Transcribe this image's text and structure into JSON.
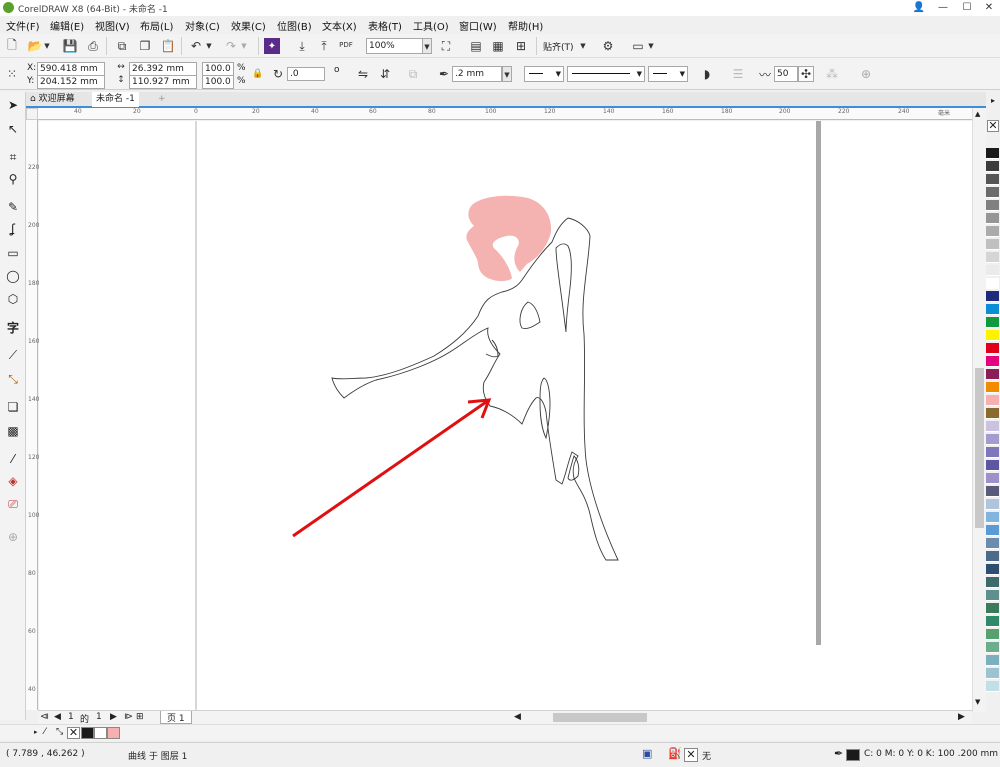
{
  "window": {
    "title": "CorelDRAW X8 (64-Bit) - 未命名 -1",
    "min": "—",
    "max": "☐",
    "close": "✕",
    "user_icon": "👤"
  },
  "menu": [
    {
      "label": "文件(F)"
    },
    {
      "label": "编辑(E)"
    },
    {
      "label": "视图(V)"
    },
    {
      "label": "布局(L)"
    },
    {
      "label": "对象(C)"
    },
    {
      "label": "效果(C)"
    },
    {
      "label": "位图(B)"
    },
    {
      "label": "文本(X)"
    },
    {
      "label": "表格(T)"
    },
    {
      "label": "工具(O)"
    },
    {
      "label": "窗口(W)"
    },
    {
      "label": "帮助(H)"
    }
  ],
  "toolbar": {
    "zoom": "100%",
    "snap_label": "贴齐(T)",
    "pdf_label": "PDF"
  },
  "propbar": {
    "x_label": "X:",
    "x_value": "590.418 mm",
    "y_label": "Y:",
    "y_value": "204.152 mm",
    "w_value": "26.392 mm",
    "h_value": "110.927 mm",
    "sx_value": "100.0",
    "sy_value": "100.0",
    "pct": "%",
    "rotation": ".0",
    "deg": "o",
    "outline_width": ".2 mm",
    "smooth_value": "50"
  },
  "doctabs": {
    "welcome": "欢迎屏幕",
    "doc": "未命名 -1",
    "add": "+"
  },
  "ruler": {
    "h_ticks": [
      "40",
      "20",
      "0",
      "20",
      "40",
      "60",
      "80",
      "100",
      "120",
      "140",
      "160",
      "180",
      "200",
      "220",
      "240"
    ],
    "v_ticks": [
      "220",
      "200",
      "180",
      "160",
      "140",
      "120",
      "100",
      "80",
      "60",
      "40",
      "20",
      "0"
    ],
    "unit": "毫米"
  },
  "pagenav": {
    "current": "1",
    "of": "的",
    "total": "1",
    "page_tab": "页 1"
  },
  "palette": {
    "colors": [
      "#1a1a1a",
      "#3b3b3b",
      "#555555",
      "#6b6b6b",
      "#808080",
      "#969696",
      "#ababab",
      "#c0c0c0",
      "#d5d5d5",
      "#ebebeb",
      "#ffffff",
      "#1f2a7a",
      "#0a8fd6",
      "#109a3e",
      "#fff200",
      "#e1001a",
      "#e5007e",
      "#8b1e57",
      "#f18c00",
      "#f6b0b0",
      "#8a6a2e",
      "#c9c3e0",
      "#a69bd0",
      "#7f76bc",
      "#5d56a3",
      "#9e90c8",
      "#5a5a7a",
      "#b0c4de",
      "#82b4e0",
      "#5b9bd5",
      "#6a8caf",
      "#4c6a8a",
      "#2f4f6f",
      "#3f6a6a",
      "#5f8f8f",
      "#3c7a5c",
      "#2f8a6a",
      "#57a070",
      "#6aae8e",
      "#7cb0bf",
      "#9cc3cf",
      "#bfe0e8"
    ]
  },
  "doc_palette": {
    "swatches": [
      "#1a1a1a",
      "#ffffff",
      "#f6b0b0"
    ]
  },
  "status": {
    "coords": "( 7.789 , 46.262 )",
    "object": "曲线 于 图层 1",
    "fill_none": "无",
    "outline_spec": "C: 0 M: 0 Y: 0 K: 100  .200 mm"
  },
  "artwork": {
    "figure_fill": "#f4b3b0",
    "outline_color": "#3a3a3a",
    "arrow_color": "#e01010"
  }
}
